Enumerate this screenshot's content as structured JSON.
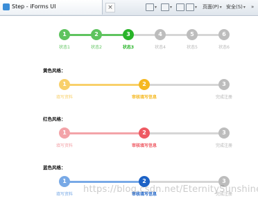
{
  "browser": {
    "tab_title": "Step - iForms UI",
    "close_glyph": "×",
    "toolbar": {
      "page_label": "页面(P)",
      "safety_label": "安全(S)",
      "more_glyph": "»"
    }
  },
  "colors": {
    "green": "#5ec35e",
    "green_active": "#28b428",
    "gray": "#bdbdbd",
    "gray_line": "#d6d6d6",
    "yellow": "#f5b820",
    "yellow_light": "#f8d06a",
    "red": "#ee5a63",
    "red_light": "#f3a3a8",
    "blue": "#1c62c6",
    "blue_light": "#78a9e6"
  },
  "steps_default": {
    "items": [
      {
        "num": "1",
        "label": "状态1"
      },
      {
        "num": "2",
        "label": "状态2"
      },
      {
        "num": "3",
        "label": "状态3"
      },
      {
        "num": "4",
        "label": "状态4"
      },
      {
        "num": "5",
        "label": "状态5"
      },
      {
        "num": "6",
        "label": "状态6"
      }
    ],
    "current": 3
  },
  "sections": [
    {
      "title": "黄色风格：",
      "style": "yellow",
      "items": [
        {
          "num": "1",
          "label": "填写资料"
        },
        {
          "num": "2",
          "label": "审核填写信息"
        },
        {
          "num": "3",
          "label": "完成注册"
        }
      ],
      "current": 2
    },
    {
      "title": "红色风格：",
      "style": "red",
      "items": [
        {
          "num": "1",
          "label": "填写资料"
        },
        {
          "num": "2",
          "label": "审核填写信息"
        },
        {
          "num": "3",
          "label": "完成注册"
        }
      ],
      "current": 2
    },
    {
      "title": "蓝色风格：",
      "style": "blue",
      "items": [
        {
          "num": "1",
          "label": "填写资料"
        },
        {
          "num": "2",
          "label": "审核填写信息"
        },
        {
          "num": "3",
          "label": "完成注册"
        }
      ],
      "current": 2
    }
  ],
  "watermark": "https://blog.csdn.net/EternitySunshine"
}
